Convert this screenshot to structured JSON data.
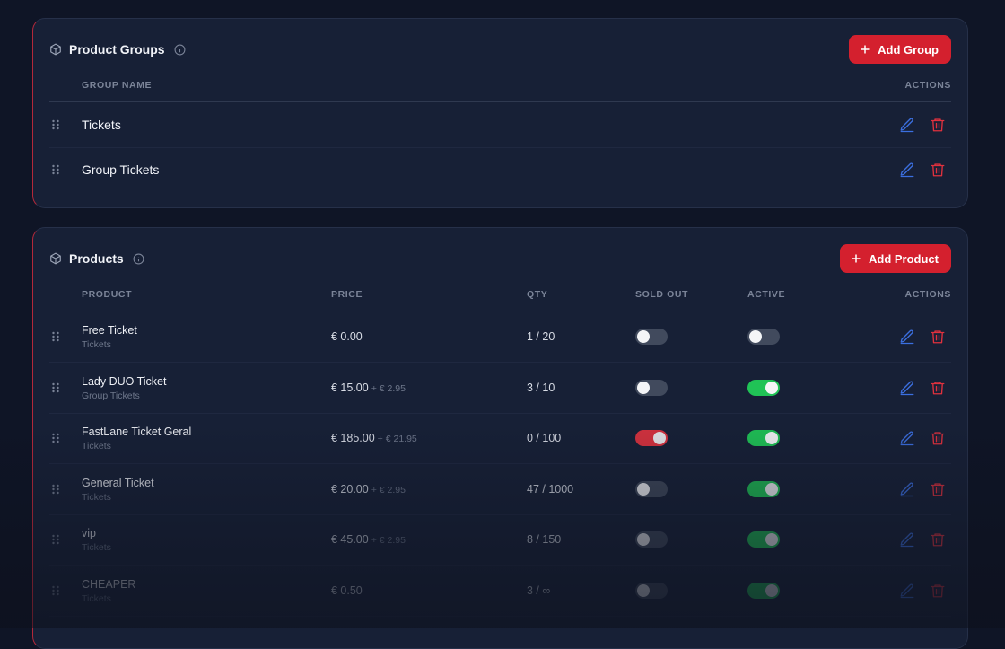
{
  "groups_card": {
    "title": "Product Groups",
    "add_label": "Add Group",
    "columns": {
      "name": "GROUP NAME",
      "actions": "ACTIONS"
    },
    "rows": [
      {
        "name": "Tickets"
      },
      {
        "name": "Group Tickets"
      }
    ]
  },
  "products_card": {
    "title": "Products",
    "add_label": "Add Product",
    "columns": {
      "product": "PRODUCT",
      "price": "PRICE",
      "qty": "QTY",
      "sold_out": "SOLD OUT",
      "active": "ACTIVE",
      "actions": "ACTIONS"
    },
    "rows": [
      {
        "name": "Free Ticket",
        "group": "Tickets",
        "price": "€ 0.00",
        "fee": "",
        "qty": "1 / 20",
        "sold_out": false,
        "active": false
      },
      {
        "name": "Lady DUO Ticket",
        "group": "Group Tickets",
        "price": "€ 15.00",
        "fee": "+ € 2.95",
        "qty": "3 / 10",
        "sold_out": false,
        "active": true
      },
      {
        "name": "FastLane Ticket Geral",
        "group": "Tickets",
        "price": "€ 185.00",
        "fee": "+ € 21.95",
        "qty": "0 / 100",
        "sold_out": true,
        "active": true
      },
      {
        "name": "General Ticket",
        "group": "Tickets",
        "price": "€ 20.00",
        "fee": "+ € 2.95",
        "qty": "47 / 1000",
        "sold_out": false,
        "active": true
      },
      {
        "name": "vip",
        "group": "Tickets",
        "price": "€ 45.00",
        "fee": "+ € 2.95",
        "qty": "8 / 150",
        "sold_out": false,
        "active": true
      },
      {
        "name": "CHEAPER",
        "group": "Tickets",
        "price": "€ 0.50",
        "fee": "",
        "qty": "3 / ∞",
        "sold_out": false,
        "active": true
      }
    ]
  },
  "icons": {
    "section": "box-icon",
    "info": "info-icon",
    "add": "plus-icon",
    "drag": "drag-handle-icon",
    "edit": "pencil-icon",
    "delete": "trash-icon"
  },
  "colors": {
    "accent_red": "#d4202e",
    "edit_blue": "#3b6fe0",
    "delete_red": "#e0313e",
    "toggle_green": "#20c356",
    "toggle_off": "#414a5d"
  }
}
